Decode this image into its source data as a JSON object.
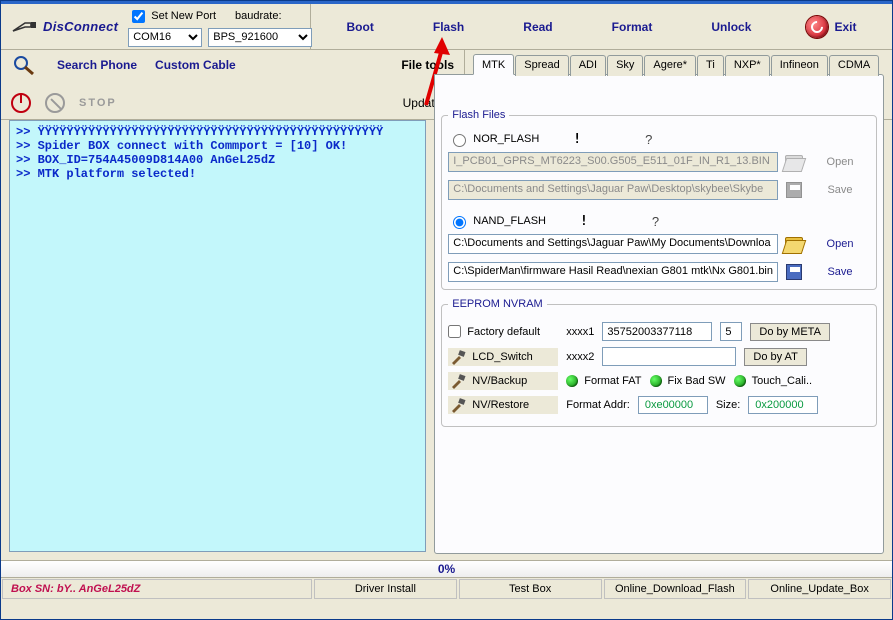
{
  "toolbar": {
    "disconnect": "DisConnect",
    "set_new_port_label": "Set New Port",
    "set_new_port_checked": true,
    "baudrate_label": "baudrate:",
    "com_options": [
      "COM16"
    ],
    "com_value": "COM16",
    "baud_options": [
      "BPS_921600"
    ],
    "baud_value": "BPS_921600",
    "boot": "Boot",
    "flash": "Flash",
    "read": "Read",
    "format": "Format",
    "unlock": "Unlock",
    "exit": "Exit"
  },
  "row2": {
    "search_phone": "Search Phone",
    "custom_cable": "Custom Cable",
    "file_tools": "File tools",
    "stop": "STOP",
    "updates": "Updates?"
  },
  "tabs": [
    "MTK",
    "Spread",
    "ADI",
    "Sky",
    "Agere*",
    "Ti",
    "NXP*",
    "Infineon",
    "CDMA"
  ],
  "active_tab": "MTK",
  "flash_files": {
    "legend": "Flash Files",
    "nor_label": "NOR_FLASH",
    "nand_label": "NAND_FLASH",
    "selected": "NAND_FLASH",
    "nor_path1": "I_PCB01_GPRS_MT6223_S00.G505_E511_01F_IN_R1_13.BIN",
    "nor_path2": "C:\\Documents and Settings\\Jaguar Paw\\Desktop\\skybee\\Skybe",
    "nand_path1": "C:\\Documents and Settings\\Jaguar Paw\\My Documents\\Downloa",
    "nand_path2": "C:\\SpiderMan\\firmware Hasil Read\\nexian G801 mtk\\Nx G801.bin",
    "open": "Open",
    "save": "Save"
  },
  "eeprom": {
    "legend": "EEPROM NVRAM",
    "factory_default": "Factory default",
    "lcd_switch": "LCD_Switch",
    "nv_backup": "NV/Backup",
    "nv_restore": "NV/Restore",
    "xxxx1": "xxxx1",
    "xxxx2": "xxxx2",
    "xxxx1_val": "35752003377118",
    "xxxx1_extra": "5",
    "xxxx2_val": "",
    "do_meta": "Do by META",
    "do_at": "Do by AT",
    "format_fat": "Format FAT",
    "fix_bad_sw": "Fix Bad SW",
    "touch_cali": "Touch_Cali..",
    "format_addr_label": "Format Addr:",
    "format_addr": "0xe00000",
    "size_label": "Size:",
    "size": "0x200000"
  },
  "console_lines": [
    ">> ŸŸŸŸŸŸŸŸŸŸŸŸŸŸŸŸŸŸŸŸŸŸŸŸŸŸŸŸŸŸŸŸŸŸŸŸŸŸŸŸŸŸŸŸŸŸŸŸ",
    ">> Spider BOX connect with Commport = [10] OK!",
    ">> BOX_ID=754A45009D814A00 AnGeL25dZ",
    ">> MTK platform selected!"
  ],
  "progress": "0%",
  "status": {
    "sn": "Box SN: bY.. AnGeL25dZ",
    "driver_install": "Driver Install",
    "test_box": "Test Box",
    "online_download_flash": "Online_Download_Flash",
    "online_update_box": "Online_Update_Box"
  }
}
